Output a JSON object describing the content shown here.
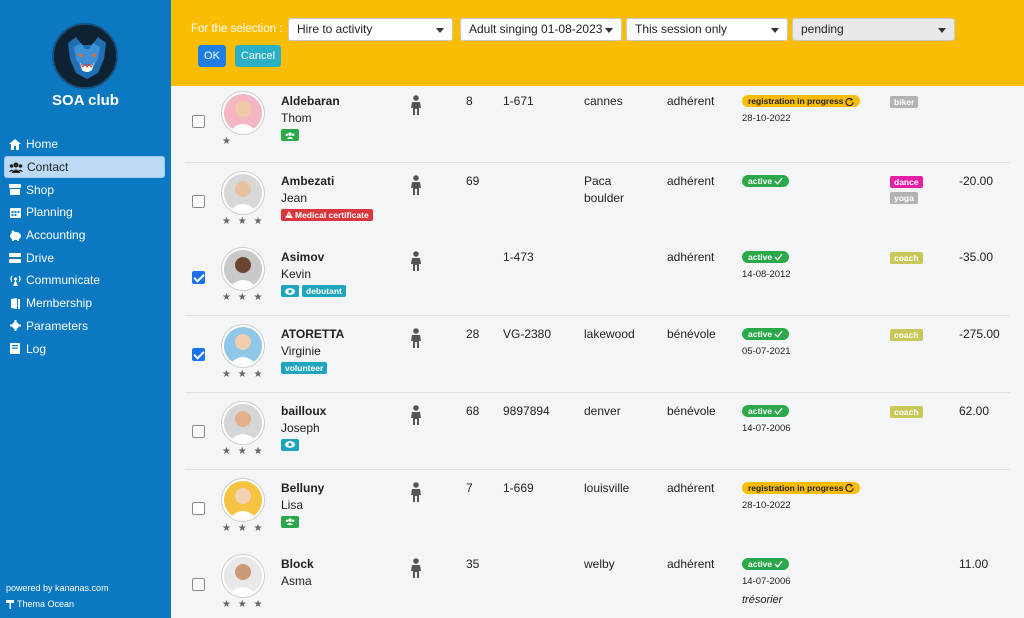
{
  "sidebar": {
    "club_name": "SOA club",
    "items": [
      {
        "label": "Home",
        "icon": "home-icon",
        "active": false
      },
      {
        "label": "Contact",
        "icon": "users-icon",
        "active": true
      },
      {
        "label": "Shop",
        "icon": "shop-icon",
        "active": false
      },
      {
        "label": "Planning",
        "icon": "calendar-icon",
        "active": false
      },
      {
        "label": "Accounting",
        "icon": "piggy-bank-icon",
        "active": false
      },
      {
        "label": "Drive",
        "icon": "drive-icon",
        "active": false
      },
      {
        "label": "Communicate",
        "icon": "broadcast-icon",
        "active": false
      },
      {
        "label": "Membership",
        "icon": "door-icon",
        "active": false
      },
      {
        "label": "Parameters",
        "icon": "gear-icon",
        "active": false
      },
      {
        "label": "Log",
        "icon": "log-icon",
        "active": false
      }
    ],
    "powered": "powered by kananas.com",
    "theme": "Thema Ocean",
    "color": "#0b78c2"
  },
  "topbar": {
    "label": "For the selection :",
    "selects": [
      {
        "value": "Hire to activity"
      },
      {
        "value": "Adult singing 01-08-2023"
      },
      {
        "value": "This session only"
      },
      {
        "value": "pending"
      }
    ],
    "ok": "OK",
    "cancel": "Cancel",
    "color": "#fbbc04"
  },
  "contacts": [
    {
      "last": "Aldebaran",
      "first": "Thom",
      "stars": "★",
      "checked": false,
      "tags": [
        {
          "type": "group",
          "color": "green"
        }
      ],
      "age": "8",
      "code": "1-671",
      "city": "cannes",
      "city2": "",
      "type": "adhérent",
      "status": "registration in progress",
      "status_kind": "pending",
      "date": "28-10-2022",
      "role": "",
      "activities": [
        "biker"
      ],
      "balance": ""
    },
    {
      "last": "Ambezati",
      "first": "Jean",
      "stars": "★ ★ ★",
      "checked": false,
      "tags": [
        {
          "type": "text",
          "text": "Medical certificate",
          "color": "red"
        }
      ],
      "age": "69",
      "code": "",
      "city": "Paca",
      "city2": "boulder",
      "type": "adhérent",
      "status": "active",
      "status_kind": "active",
      "date": "",
      "role": "",
      "activities": [
        "dance",
        "yoga"
      ],
      "balance": "-20.00"
    },
    {
      "last": "Asimov",
      "first": "Kevin",
      "stars": "★ ★ ★",
      "checked": true,
      "tags": [
        {
          "type": "eye",
          "color": "teal"
        },
        {
          "type": "text",
          "text": "debutant",
          "color": "teal"
        }
      ],
      "age": "",
      "code": "1-473",
      "city": "",
      "city2": "",
      "type": "adhérent",
      "status": "active",
      "status_kind": "active",
      "date": "14-08-2012",
      "role": "",
      "activities": [
        "coach"
      ],
      "balance": "-35.00"
    },
    {
      "last": "ATORETTA",
      "first": "Virginie",
      "stars": "★ ★ ★",
      "checked": true,
      "tags": [
        {
          "type": "text",
          "text": "volunteer",
          "color": "teal"
        }
      ],
      "age": "28",
      "code": "VG-2380",
      "city": "lakewood",
      "city2": "",
      "type": "bénévole",
      "status": "active",
      "status_kind": "active",
      "date": "05-07-2021",
      "role": "",
      "activities": [
        "coach"
      ],
      "balance": "-275.00"
    },
    {
      "last": "bailloux",
      "first": "Joseph",
      "stars": "★ ★ ★",
      "checked": false,
      "tags": [
        {
          "type": "eye",
          "color": "teal"
        }
      ],
      "age": "68",
      "code": "9897894",
      "city": "denver",
      "city2": "",
      "type": "bénévole",
      "status": "active",
      "status_kind": "active",
      "date": "14-07-2006",
      "role": "",
      "activities": [
        "coach"
      ],
      "balance": "62.00"
    },
    {
      "last": "Belluny",
      "first": "Lisa",
      "stars": "★ ★ ★",
      "checked": false,
      "tags": [
        {
          "type": "group",
          "color": "green"
        }
      ],
      "age": "7",
      "code": "1-669",
      "city": "louisville",
      "city2": "",
      "type": "adhérent",
      "status": "registration in progress",
      "status_kind": "pending",
      "date": "28-10-2022",
      "role": "",
      "activities": [],
      "balance": ""
    },
    {
      "last": "Block",
      "first": "Asma",
      "stars": "★ ★ ★",
      "checked": false,
      "tags": [],
      "age": "35",
      "code": "",
      "city": "welby",
      "city2": "",
      "type": "adhérent",
      "status": "active",
      "status_kind": "active",
      "date": "14-07-2006",
      "role": "trésorier",
      "activities": [],
      "balance": "11.00"
    }
  ]
}
